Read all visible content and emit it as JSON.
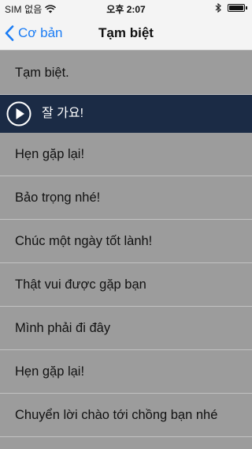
{
  "status_bar": {
    "carrier": "SIM 없음",
    "time": "오후 2:07",
    "battery_level": 1.0
  },
  "nav": {
    "back_label": "Cơ bản",
    "title": "Tạm biệt"
  },
  "phrases": [
    {
      "text": "Tạm biệt."
    },
    {
      "text": "잘 가요!",
      "playing": true
    },
    {
      "text": "Hẹn gặp lại!"
    },
    {
      "text": "Bảo trọng nhé!"
    },
    {
      "text": "Chúc một ngày tốt lành!"
    },
    {
      "text": "Thật vui được gặp bạn"
    },
    {
      "text": "Mình phải đi đây"
    },
    {
      "text": "Hẹn gặp lại!"
    },
    {
      "text": "Chuyển lời chào tới chồng bạn nhé"
    }
  ],
  "colors": {
    "accent": "#1a7cf5",
    "row_background": "#9c9c9c",
    "active_row_background": "#1b2b45"
  },
  "icons": {
    "back": "chevron-left-icon",
    "play": "play-circle-icon",
    "wifi": "wifi-icon",
    "bluetooth": "bluetooth-icon",
    "battery": "battery-icon"
  }
}
